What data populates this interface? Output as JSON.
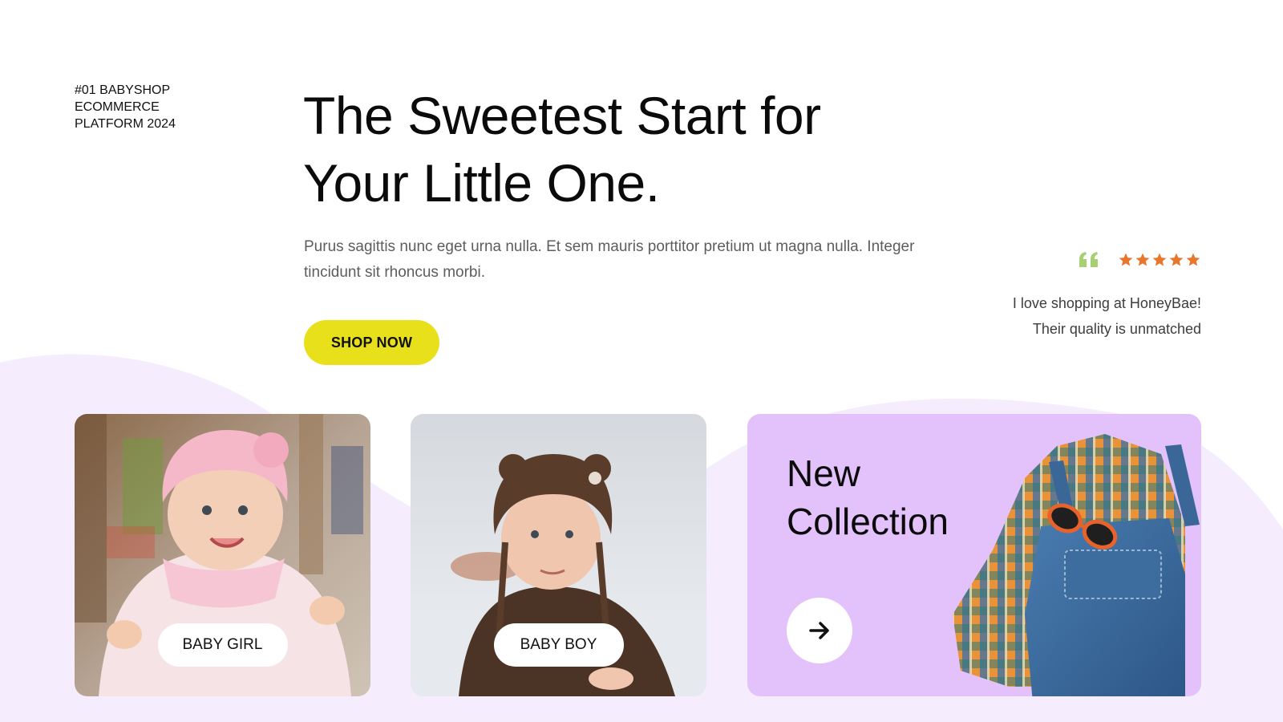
{
  "eyebrow": {
    "line1": "#01 BABYSHOP",
    "line2": "ECOMMERCE",
    "line3": "PLATFORM 2024"
  },
  "hero": {
    "title_line1": "The Sweetest Start for",
    "title_line2": "Your Little One.",
    "description": "Purus sagittis nunc eget urna nulla. Et sem mauris porttitor pretium ut magna nulla. Integer tincidunt sit rhoncus morbi.",
    "cta_label": "SHOP NOW"
  },
  "review": {
    "rating": 5,
    "icon": "quote-icon",
    "text": "I love shopping at HoneyBae! Their quality is unmatched"
  },
  "cards": {
    "girl": {
      "label": "BABY GIRL",
      "image": "baby-girl-photo"
    },
    "boy": {
      "label": "BABY BOY",
      "image": "baby-boy-photo"
    },
    "collection": {
      "title_line1": "New",
      "title_line2": "Collection",
      "icon": "arrow-right-icon",
      "image": "kids-outfit-photo"
    }
  },
  "colors": {
    "accent_yellow": "#e9e01c",
    "card_lavender": "#e3c2fb",
    "star_orange": "#e8762b",
    "quote_green": "#a9cf73",
    "wave_lilac": "#f5ecfd"
  }
}
